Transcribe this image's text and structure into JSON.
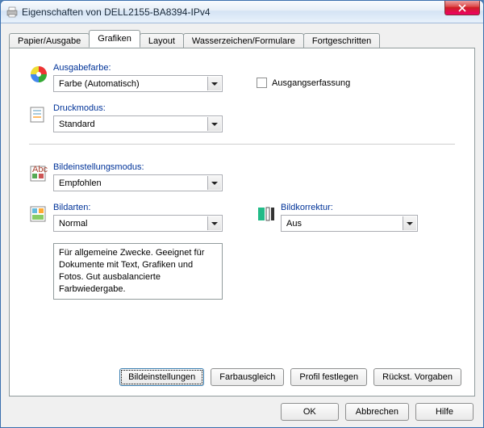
{
  "window": {
    "title": "Eigenschaften von DELL2155-BA8394-IPv4"
  },
  "tabs": {
    "t0": "Papier/Ausgabe",
    "t1": "Grafiken",
    "t2": "Layout",
    "t3": "Wasserzeichen/Formulare",
    "t4": "Fortgeschritten"
  },
  "fields": {
    "output_color": {
      "label": "Ausgabefarbe:",
      "value": "Farbe (Automatisch)"
    },
    "output_capture": {
      "label": "Ausgangserfassung",
      "checked": false
    },
    "print_mode": {
      "label": "Druckmodus:",
      "value": "Standard"
    },
    "image_setting_mode": {
      "label": "Bildeinstellungsmodus:",
      "value": "Empfohlen"
    },
    "image_types": {
      "label": "Bildarten:",
      "value": "Normal"
    },
    "image_correction": {
      "label": "Bildkorrektur:",
      "value": "Aus"
    },
    "description": "Für allgemeine Zwecke. Geeignet für Dokumente mit Text, Grafiken und Fotos. Gut ausbalancierte Farbwiedergabe."
  },
  "inner_buttons": {
    "b0": "Bildeinstellungen",
    "b1": "Farbausgleich",
    "b2": "Profil festlegen",
    "b3": "Rückst. Vorgaben"
  },
  "buttons": {
    "ok": "OK",
    "cancel": "Abbrechen",
    "help": "Hilfe"
  }
}
